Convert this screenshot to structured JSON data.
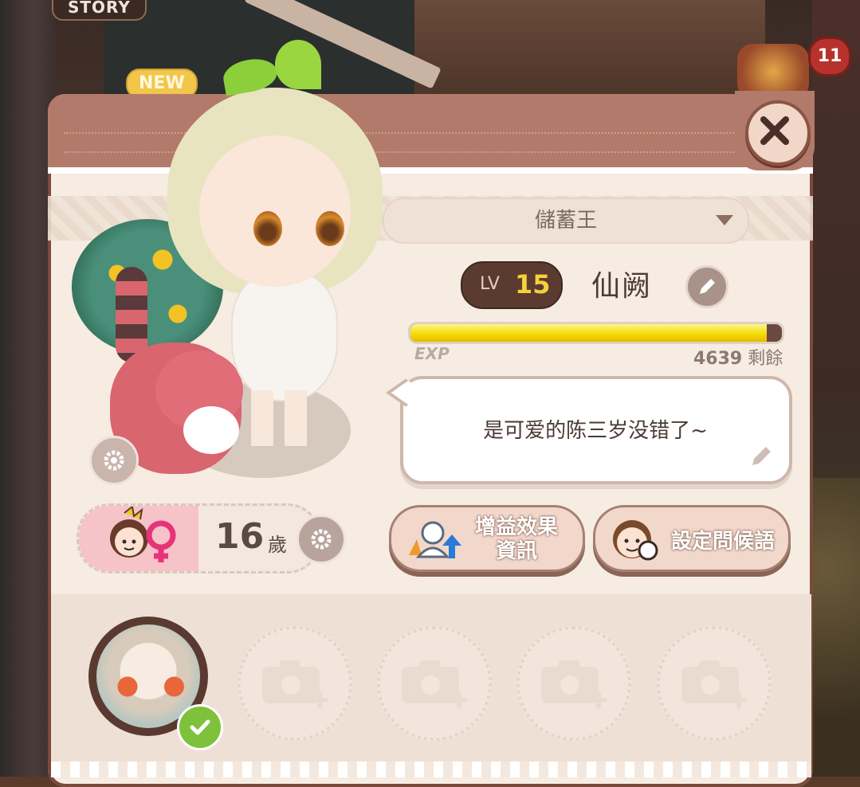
{
  "hud": {
    "story_tab": "STORY",
    "new_tag": "NEW",
    "notification_count": "11"
  },
  "profile": {
    "title_selected": "儲蓄王",
    "level_prefix": "LV",
    "level": "15",
    "name": "仙阙",
    "exp_label": "EXP",
    "exp_remaining_value": "4639",
    "exp_remaining_suffix": "剩餘",
    "exp_progress": 0.96,
    "status_message": "是可爱的陈三岁没错了~",
    "age_value": "16",
    "age_unit": "歲"
  },
  "buttons": {
    "buff_info": "增益效果資訊",
    "set_greeting": "設定問候語"
  },
  "photos": {
    "selected_index": 0,
    "empty_slots": 4
  },
  "colors": {
    "header": "#b27a6a",
    "exp_fill": "#f3d800",
    "check": "#7ec13b",
    "notification": "#b8322d"
  },
  "icons": [
    "close-icon",
    "dropdown-icon",
    "edit-icon",
    "settings-icon",
    "gender-female-icon",
    "buff-icon",
    "greeting-icon",
    "camera-icon",
    "check-icon"
  ]
}
